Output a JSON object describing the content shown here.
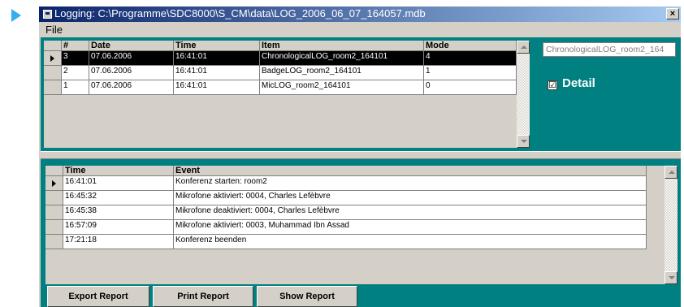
{
  "window": {
    "title": "Logging: C:\\Programme\\SDC8000\\S_CM\\data\\LOG_2006_06_07_164057.mdb",
    "close_glyph": "×"
  },
  "menu": {
    "file": "File"
  },
  "log_table": {
    "headers": {
      "num": "#",
      "date": "Date",
      "time": "Time",
      "item": "Item",
      "mode": "Mode"
    },
    "rows": [
      {
        "num": "3",
        "date": "07.06.2006",
        "time": "16:41:01",
        "item": "ChronologicalLOG_room2_164101",
        "mode": "4"
      },
      {
        "num": "2",
        "date": "07.06.2006",
        "time": "16:41:01",
        "item": "BadgeLOG_room2_164101",
        "mode": "1"
      },
      {
        "num": "1",
        "date": "07.06.2006",
        "time": "16:41:01",
        "item": "MicLOG_room2_164101",
        "mode": "0"
      }
    ],
    "selected_row": 0
  },
  "side": {
    "item_field_value": "ChronologicalLOG_room2_164",
    "detail_checked_glyph": "☑",
    "detail_label": "Detail"
  },
  "event_table": {
    "headers": {
      "time": "Time",
      "event": "Event"
    },
    "rows": [
      {
        "time": "16:41:01",
        "event": "Konferenz starten: room2"
      },
      {
        "time": "16:45:32",
        "event": "Mikrofone aktiviert: 0004, Charles Lefèbvre"
      },
      {
        "time": "16:45:38",
        "event": "Mikrofone deaktiviert: 0004, Charles Lefèbvre"
      },
      {
        "time": "16:57:09",
        "event": "Mikrofone aktiviert: 0003, Muhammad Ibn Assad"
      },
      {
        "time": "17:21:18",
        "event": "Konferenz beenden"
      }
    ]
  },
  "buttons": {
    "export": "Export Report",
    "print": "Print Report",
    "show": "Show Report"
  },
  "colors": {
    "panel": "#008080",
    "face": "#d4d0c8",
    "title_start": "#0a246a",
    "pointer": "#35aef0"
  }
}
